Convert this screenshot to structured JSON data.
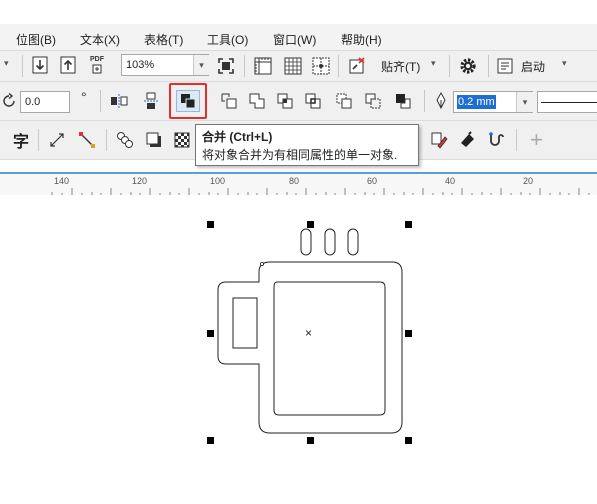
{
  "menu": {
    "items": [
      "位图(B)",
      "文本(X)",
      "表格(T)",
      "工具(O)",
      "窗口(W)",
      "帮助(H)"
    ]
  },
  "toolbar": {
    "pdf_label": "PDF",
    "zoom_value": "103%",
    "snap_label": "贴齐(T)",
    "launch_label": "启动"
  },
  "propertybar": {
    "rotation_value": "0.0",
    "degree_symbol": "°",
    "outline_width": "0.2 mm"
  },
  "toolbox": {
    "text_tool_glyph": "字",
    "plus_glyph": "+"
  },
  "tooltip": {
    "title": "合并 (Ctrl+L)",
    "description": "将对象合并为有相同属性的单一对象."
  },
  "ruler": {
    "labels": [
      "140",
      "120",
      "100",
      "80",
      "60",
      "40",
      "20"
    ]
  },
  "canvas": {
    "center_marker": "×"
  },
  "colors": {
    "highlight_red": "#e03030",
    "selection_blue": "#1e6fd0",
    "ruler_accent": "#5aa0d8"
  }
}
